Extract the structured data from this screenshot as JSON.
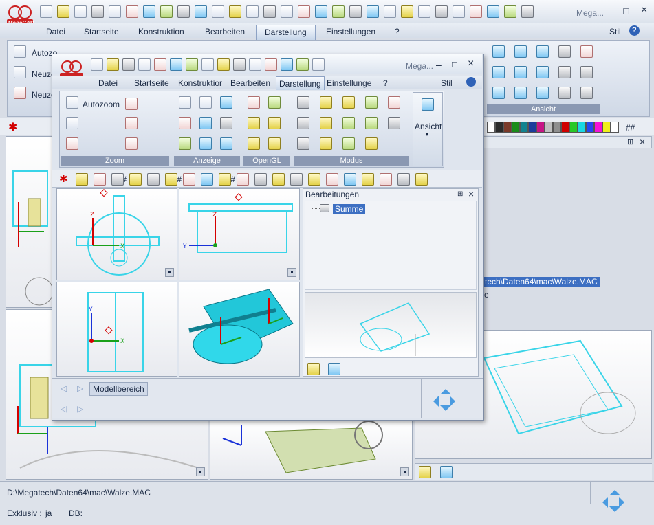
{
  "app": {
    "logo_text": "MegaCAD",
    "brand_truncated": "Mega...",
    "window_controls": {
      "minimize": "–",
      "restore": "□",
      "close": "×"
    }
  },
  "main_menu": {
    "items": [
      "Datei",
      "Startseite",
      "Konstruktion",
      "Bearbeiten",
      "Darstellung",
      "Einstellungen",
      "?"
    ],
    "active": "Darstellung",
    "stil_label": "Stil",
    "help": "?"
  },
  "main_ribbon": {
    "zoom_labels": [
      "Autozoom",
      "Neuzeichnen",
      "Neuzeichnen"
    ],
    "truncated_labels": [
      "Autozo",
      "Neuze",
      "Neuze"
    ],
    "group_labels": [
      "Ansicht"
    ]
  },
  "popup": {
    "brand": "Mega...",
    "menu": [
      "Datei",
      "Startseite",
      "Konstruktior",
      "Bearbeiten",
      "Darstellung",
      "Einstellunge",
      "?"
    ],
    "active": "Darstellung",
    "stil_label": "Stil",
    "ribbon": {
      "autozoom_label": "Autozoom",
      "group_labels": [
        "Zoom",
        "Anzeige",
        "OpenGL",
        "Modus"
      ],
      "ansicht_label": "Ansicht"
    },
    "toolbar_hash_labels": [
      "###",
      "###",
      "###"
    ],
    "tree_panel": {
      "title": "Bearbeitungen",
      "pin": "⊞",
      "close": "×",
      "node": "Summe"
    },
    "bottom_tab": "Modellbereich"
  },
  "main_area": {
    "path_highlight": "tech\\Daten64\\mac\\Walze.MAC",
    "text_e": "e",
    "pin": "⊞",
    "close": "×",
    "hash_sym": "##"
  },
  "status": {
    "path": "D:\\Megatech\\Daten64\\mac\\Walze.MAC",
    "exklusiv_label": "Exklusiv :",
    "exklusiv_value": "ja",
    "db_label": "DB:"
  },
  "colors": {
    "accent": "#3d6fc2",
    "wire": "#39d4e8",
    "axis_red": "#d40000",
    "axis_green": "#1aa01a",
    "axis_blue": "#1a32d8"
  }
}
